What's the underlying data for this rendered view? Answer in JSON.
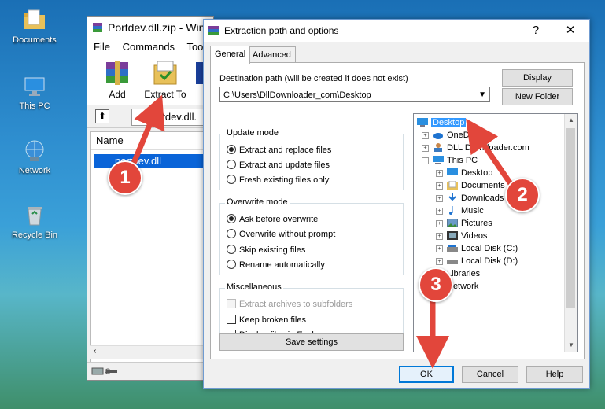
{
  "desktop": {
    "icons": [
      {
        "name": "documents",
        "label": "Documents"
      },
      {
        "name": "this-pc",
        "label": "This PC"
      },
      {
        "name": "network",
        "label": "Network"
      },
      {
        "name": "recycle-bin",
        "label": "Recycle Bin"
      }
    ]
  },
  "winrar": {
    "title": "Portdev.dll.zip - Win",
    "menu": [
      "File",
      "Commands",
      "Tools"
    ],
    "toolbar": {
      "add": "Add",
      "extract_to": "Extract To"
    },
    "path": "Portdev.dll.",
    "list_header": "Name",
    "file": "portdev.dll"
  },
  "dialog": {
    "title": "Extraction path and options",
    "help": "?",
    "close": "✕",
    "tabs": [
      "General",
      "Advanced"
    ],
    "dest_label": "Destination path (will be created if does not exist)",
    "dest_value": "C:\\Users\\DllDownloader_com\\Desktop",
    "display_button": "Display",
    "new_folder_button": "New Folder",
    "update_mode": {
      "title": "Update mode",
      "options": [
        "Extract and replace files",
        "Extract and update files",
        "Fresh existing files only"
      ],
      "selected": 0
    },
    "overwrite_mode": {
      "title": "Overwrite mode",
      "options": [
        "Ask before overwrite",
        "Overwrite without prompt",
        "Skip existing files",
        "Rename automatically"
      ],
      "selected": 0
    },
    "misc": {
      "title": "Miscellaneous",
      "options": [
        "Extract archives to subfolders",
        "Keep broken files",
        "Display files in Explorer"
      ]
    },
    "save_settings": "Save settings",
    "tree": [
      {
        "label": "Desktop",
        "level": 0,
        "selected": true
      },
      {
        "label": "OneDrive",
        "level": 1
      },
      {
        "label": "DLL Downloader.com",
        "level": 1
      },
      {
        "label": "This PC",
        "level": 1
      },
      {
        "label": "Desktop",
        "level": 2
      },
      {
        "label": "Documents",
        "level": 2
      },
      {
        "label": "Downloads",
        "level": 2
      },
      {
        "label": "Music",
        "level": 2
      },
      {
        "label": "Pictures",
        "level": 2
      },
      {
        "label": "Videos",
        "level": 2
      },
      {
        "label": "Local Disk (C:)",
        "level": 2
      },
      {
        "label": "Local Disk (D:)",
        "level": 2
      },
      {
        "label": "Libraries",
        "level": 1
      },
      {
        "label": "Network",
        "level": 1
      }
    ],
    "ok": "OK",
    "cancel": "Cancel",
    "help_button": "Help"
  },
  "steps": [
    "1",
    "2",
    "3"
  ],
  "colors": {
    "badge": "#e2463b",
    "selection": "#0a64d8",
    "accent": "#0078d7"
  }
}
